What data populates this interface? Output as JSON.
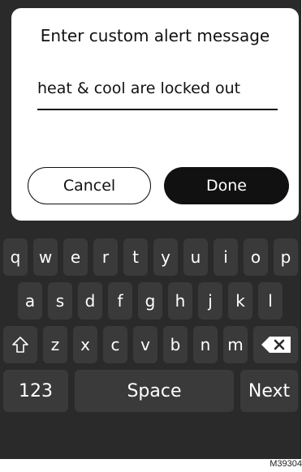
{
  "dialog": {
    "title": "Enter custom alert message",
    "input_value": "heat & cool are locked out",
    "cancel_label": "Cancel",
    "done_label": "Done"
  },
  "keyboard": {
    "row1": [
      "q",
      "w",
      "e",
      "r",
      "t",
      "y",
      "u",
      "i",
      "o",
      "p"
    ],
    "row2": [
      "a",
      "s",
      "d",
      "f",
      "g",
      "h",
      "j",
      "k",
      "l"
    ],
    "row3": [
      "z",
      "x",
      "c",
      "v",
      "b",
      "n",
      "m"
    ],
    "numbers_label": "123",
    "space_label": "Space",
    "next_label": "Next",
    "shift_icon": "shift-icon",
    "backspace_icon": "backspace-icon"
  },
  "figure_id": "M39304",
  "colors": {
    "background": "#2a2a2a",
    "key": "#3a3a3a",
    "dialog": "#ffffff",
    "done_button": "#111111"
  }
}
